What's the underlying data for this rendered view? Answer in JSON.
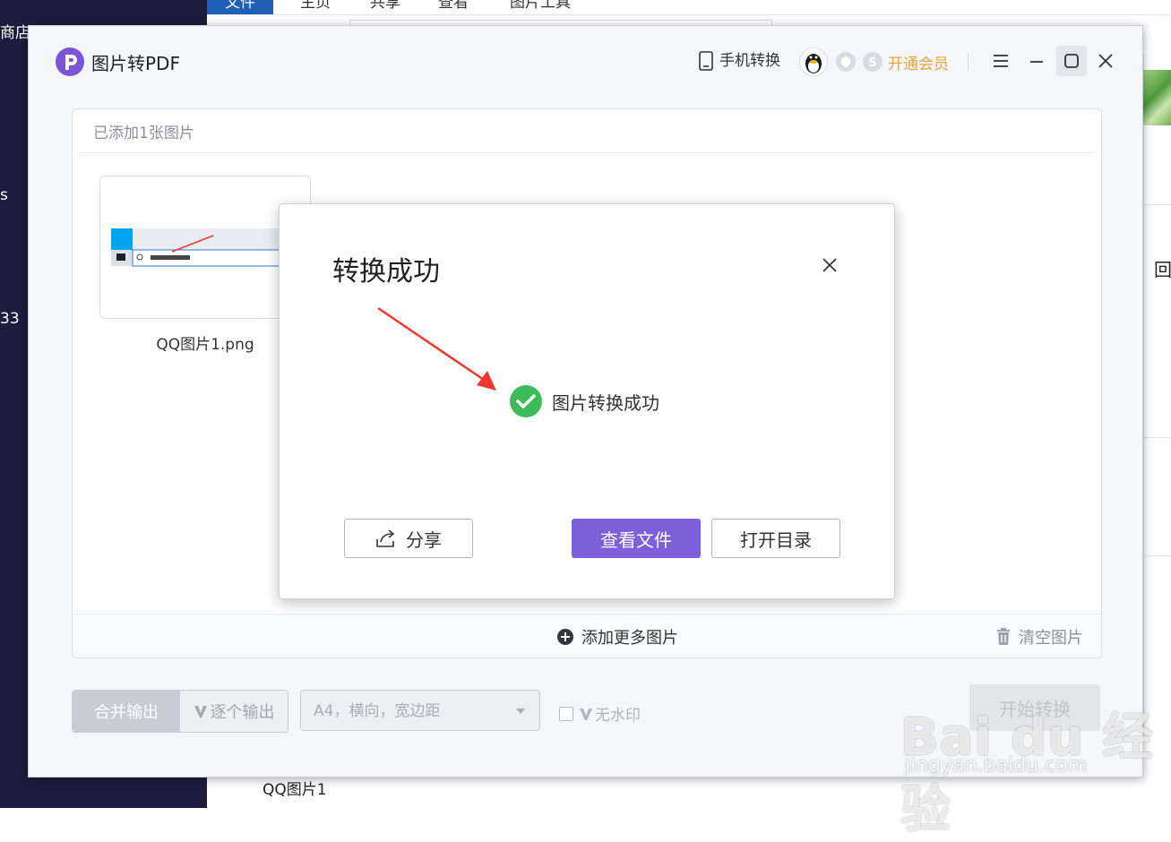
{
  "desktop": {
    "left_texts": [
      "商店",
      "s",
      "33"
    ],
    "host_tabs": [
      "文件",
      "主页",
      "共享",
      "查看",
      "图片工具"
    ],
    "host_side_text": "回",
    "host_caption": "QQ图片1"
  },
  "app": {
    "title": "图片转PDF",
    "header": {
      "phone_convert": "手机转换",
      "vip": "开通会员"
    },
    "panel": {
      "header": "已添加1张图片",
      "file_name": "QQ图片1.png",
      "add_more": "添加更多图片",
      "clear": "清空图片"
    },
    "controls": {
      "merge_output": "合并输出",
      "single_output": "逐个输出",
      "paper_option": "A4，横向，宽边距",
      "no_watermark": "无水印",
      "start": "开始转换"
    }
  },
  "modal": {
    "title": "转换成功",
    "message": "图片转换成功",
    "share": "分享",
    "view_file": "查看文件",
    "open_dir": "打开目录"
  },
  "watermark": {
    "main": "Bai du 经验",
    "sub": "jingyan.baidu.com"
  },
  "colors": {
    "accent": "#7d5fd9",
    "success": "#3dbb5b",
    "vip": "#e8a33d",
    "arrow": "#e8382f"
  },
  "icons": [
    "phone-icon",
    "avatar",
    "shield-icon",
    "coin-icon",
    "menu-icon",
    "minimize-icon",
    "maximize-icon",
    "close-icon",
    "check-circle-icon",
    "share-icon",
    "plus-circle-icon",
    "trash-icon"
  ]
}
